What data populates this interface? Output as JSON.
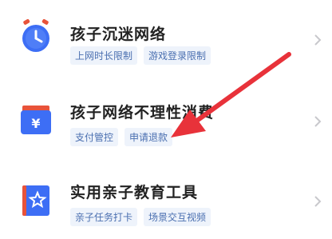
{
  "rows": [
    {
      "title": "孩子沉迷网络",
      "tags": [
        "上网时长限制",
        "游戏登录限制"
      ],
      "icon": "alarm-clock-icon"
    },
    {
      "title": "孩子网络不理性消费",
      "tags": [
        "支付管控",
        "申请退款"
      ],
      "icon": "yen-wallet-icon"
    },
    {
      "title": "实用亲子教育工具",
      "tags": [
        "亲子任务打卡",
        "场景交互视频"
      ],
      "icon": "star-book-icon"
    }
  ],
  "colors": {
    "accent": "#3d6ef5",
    "arrow": "#e8323a",
    "tag_bg": "#eef3fb",
    "tag_text": "#4a6fb0"
  }
}
